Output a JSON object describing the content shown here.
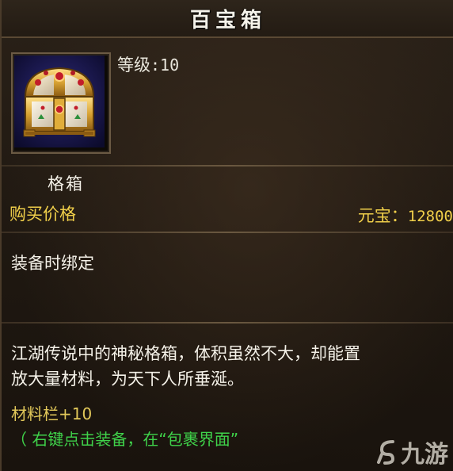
{
  "window": {
    "title": "百宝箱"
  },
  "item": {
    "level_label": "等级",
    "level_value": ":10",
    "name": "格箱",
    "icon": "treasure-chest-icon"
  },
  "price": {
    "label": "购买价格",
    "currency": "元宝：",
    "value": "12800"
  },
  "binding": {
    "text": "装备时绑定"
  },
  "description": {
    "line1": "江湖传说中的神秘格箱，体积虽然不大，却能置",
    "line2": "放大量材料，为天下人所垂涎。"
  },
  "bonus": {
    "text": "材料栏+10"
  },
  "hint": {
    "text": "（ 右键点击装备，在“包裹界面”"
  },
  "watermark": {
    "text": "九游"
  },
  "colors": {
    "title": "#f5f3ea",
    "price": "#f0cf4a",
    "bonus": "#e2c85a",
    "hint": "#3fd24a",
    "frame": "#6b5a44"
  }
}
